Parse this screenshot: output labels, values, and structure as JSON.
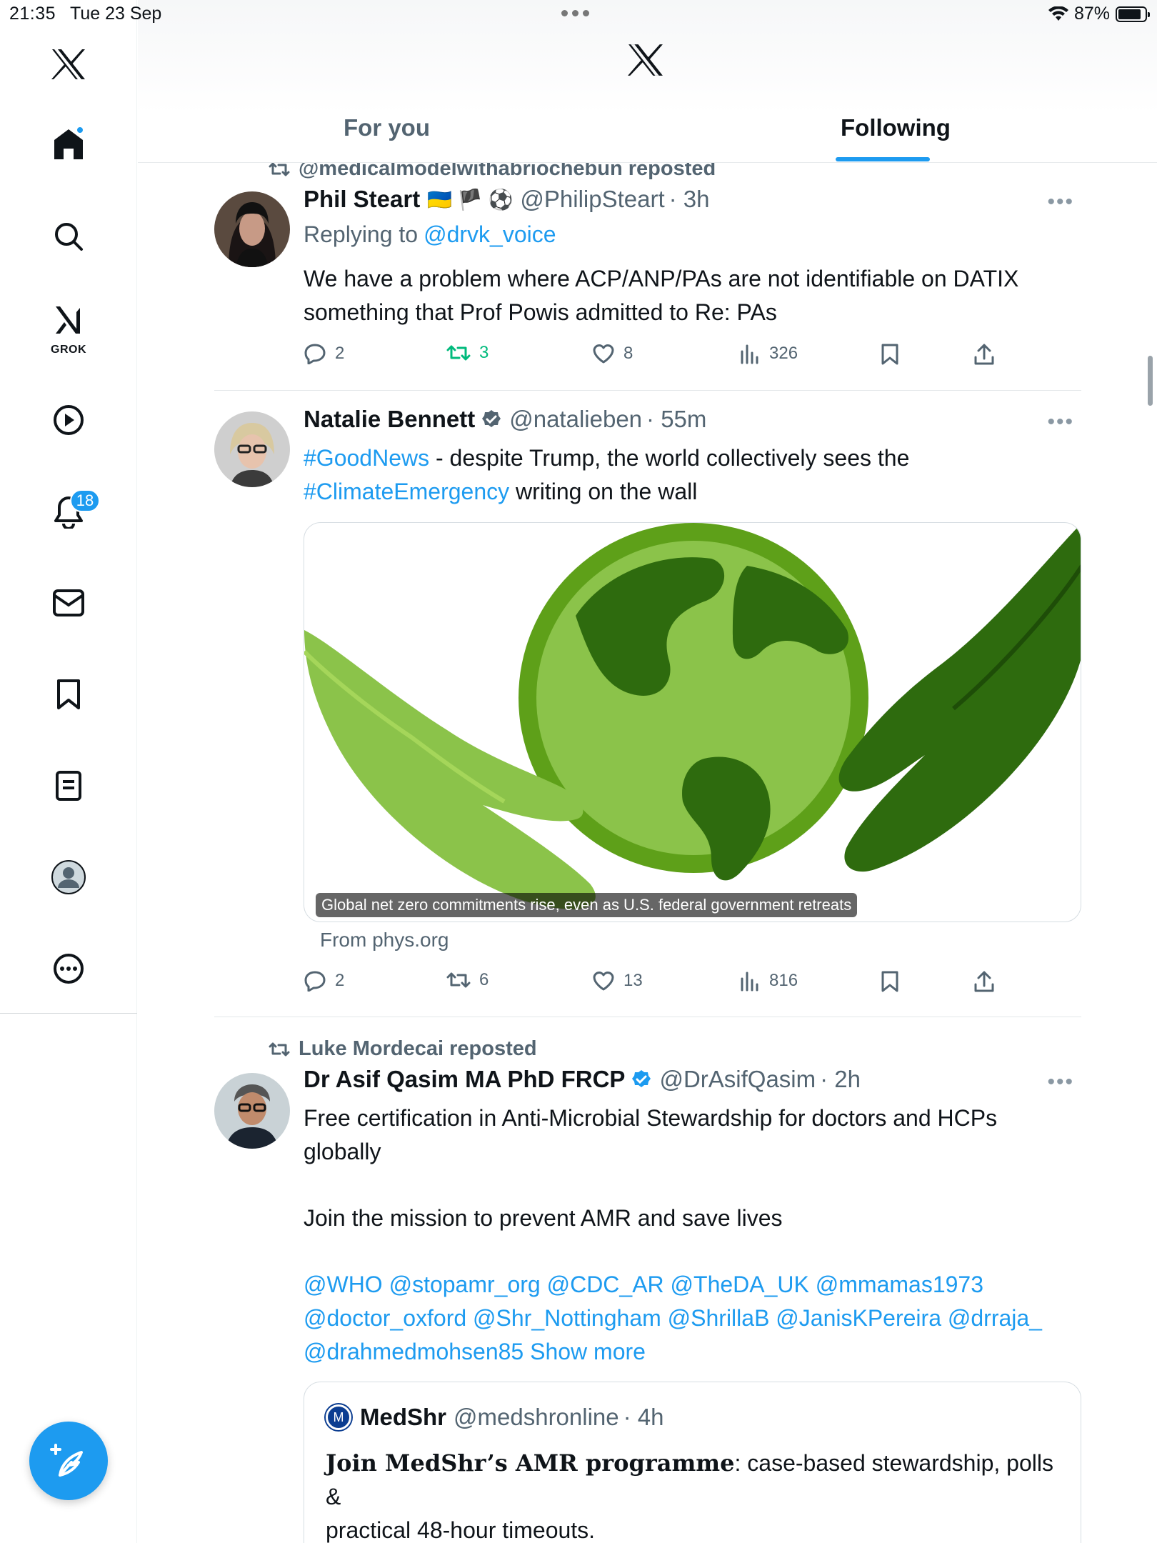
{
  "status_bar": {
    "time": "21:35",
    "date": "Tue 23 Sep",
    "battery": "87%"
  },
  "sidebar": {
    "grok_label": "GROK",
    "notification_count": "18"
  },
  "header": {
    "tabs": [
      {
        "label": "For you"
      },
      {
        "label": "Following"
      }
    ]
  },
  "posts": [
    {
      "repost_by": "@medicalmodelwithabriochebun reposted",
      "name": "Phil Steart",
      "name_emoji": "🇺🇦 🏴 ⚽",
      "handle": "@PhilipSteart",
      "time": "· 3h",
      "replying_label": "Replying to",
      "replying_to": "@drvk_voice",
      "text_line1": "We have a problem where ACP/ANP/PAs are not identifiable on DATIX",
      "text_line2": "something that Prof Powis admitted to Re: PAs",
      "replies": "2",
      "reposts": "3",
      "likes": "8",
      "views": "326"
    },
    {
      "name": "Natalie Bennett",
      "handle": "@natalieben",
      "time": "· 55m",
      "hashtag1": "#GoodNews",
      "text_part1": " - despite Trump, the world collectively sees the",
      "hashtag2": "#ClimateEmergency",
      "text_part2": " writing on the wall",
      "media_caption": "Global net zero commitments rise, even as U.S. federal government retreats",
      "link_source": "From phys.org",
      "replies": "2",
      "reposts": "6",
      "likes": "13",
      "views": "816"
    },
    {
      "repost_by": "Luke Mordecai reposted",
      "name": "Dr Asif Qasim MA PhD FRCP",
      "handle": "@DrAsifQasim",
      "time": "· 2h",
      "text_line1": "Free certification in Anti-Microbial Stewardship for doctors and HCPs",
      "text_line2": "globally",
      "text_line3": "Join the mission to prevent AMR and save lives",
      "mentions_line1": "@WHO @stopamr_org @CDC_AR @TheDA_UK @mmamas1973",
      "mentions_line2": "@doctor_oxford @Shr_Nottingham @ShrillaB @JanisKPereira @drraja_",
      "mentions_line3": "@drahmedmohsen85",
      "show_more": "Show more",
      "quote": {
        "logo_letter": "M",
        "name": "MedShr",
        "handle": "@medshronline",
        "time": "· 4h",
        "bold_text": "Join MedShr’s AMR programme",
        "text": ": case-based stewardship, polls &",
        "text_line2": "practical 48-hour timeouts."
      }
    }
  ],
  "colors": {
    "accent": "#1d9bf0",
    "repost_active": "#00ba7c",
    "secondary_text": "#536471"
  }
}
